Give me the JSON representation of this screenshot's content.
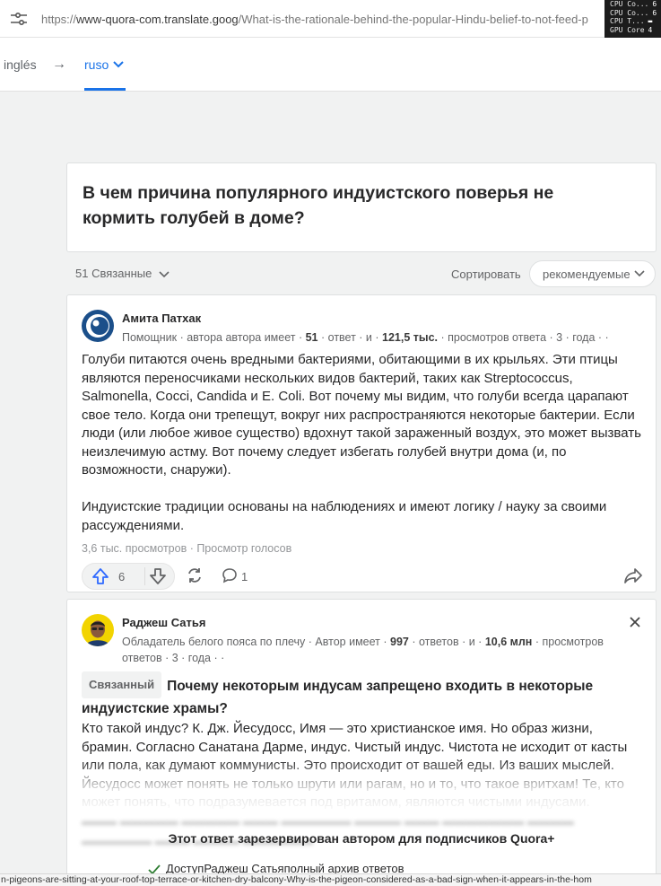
{
  "browser": {
    "url_prefix": "https://",
    "url_host": "www-quora-com.translate.goog",
    "url_path": "/What-is-the-rationale-behind-the-popular-Hindu-belief-to-not-feed-p",
    "hud": [
      {
        "label": "CPU Co...",
        "value": "6"
      },
      {
        "label": "CPU Co...",
        "value": "6"
      },
      {
        "label": "CPU T...",
        "value": ""
      },
      {
        "label": "GPU Core",
        "value": "4"
      }
    ]
  },
  "translate": {
    "source_lang": "inglés",
    "arrow": "→",
    "target_lang": "ruso"
  },
  "question": {
    "title": "В чем причина популярного индуистского поверья не кормить голубей в доме?"
  },
  "toolbar": {
    "related_label": "51 Связанные",
    "sort_label": "Сортировать",
    "sort_value": "рекомендуемые"
  },
  "answer1": {
    "author": "Амита Патхак",
    "meta_prefix": "Помощник · автора автора имеет ·",
    "answers_count": "51",
    "meta_mid": "· ответ · и ·",
    "views_count": "121,5 тыс.",
    "meta_suffix": "· просмотров ответа · 3 · года · ·",
    "paragraph1": "Голуби питаются очень вредными бактериями, обитающими в их крыльях. Эти птицы являются переносчиками нескольких видов бактерий, таких как Streptococcus, Salmonella, Cocci, Candida и E. Coli. Вот почему мы видим, что голуби всегда царапают свое тело. Когда они трепещут, вокруг них распространяются некоторые бактерии. Если люди (или любое живое существо) вдохнут такой зараженный воздух, это может вызвать неизлечимую астму. Вот почему следует избегать голубей внутри дома (и, по возможности, снаружи).",
    "paragraph2": "Индуистские традиции основаны на наблюдениях и имеют логику / науку за своими рассуждениями.",
    "views_line": "3,6 тыс. просмотров · Просмотр голосов",
    "upvotes": "6",
    "comments": "1"
  },
  "answer2": {
    "author": "Раджеш Сатья",
    "meta_prefix": "Обладатель белого пояса по плечу · Автор имеет ·",
    "answers_count": "997",
    "meta_mid": "· ответов · и ·",
    "views_count": "10,6 млн",
    "meta_suffix1": "· просмотров",
    "meta_suffix2": "ответов · 3 · года · ·",
    "related_badge": "Связанный",
    "related_question": "Почему некоторым индусам запрещено входить в некоторые индуистские храмы?",
    "body": "Кто такой индус? К. Дж. Йесудосс, Имя — это христианское имя. Но образ жизни, брамин. Согласно Санатана Дарме, индус. Чистый индус. Чистота не исходит от касты или пола, как думают коммунисты. Это происходит от вашей еды. Из ваших мыслей. Йесудосс может понять не только шрути или рагам, но и то, что такое вритхам! Те, кто может понять, что подразумевается под вритамом, являются чистыми индусами.",
    "paywall_title": "Этот ответ зарезервирован автором для подписчиков Quora+",
    "paywall_item": "ДоступРаджеш Сатьяполный архив ответов"
  },
  "statusbar": {
    "text": "n-pigeons-are-sitting-at-your-roof-top-terrace-or-kitchen-dry-balcony-Why-is-the-pigeon-considered-as-a-bad-sign-when-it-appears-in-the-hom"
  },
  "colors": {
    "accent_blue": "#1a73e8",
    "upvote_blue": "#2e69ff",
    "check_green": "#2e7d32"
  }
}
